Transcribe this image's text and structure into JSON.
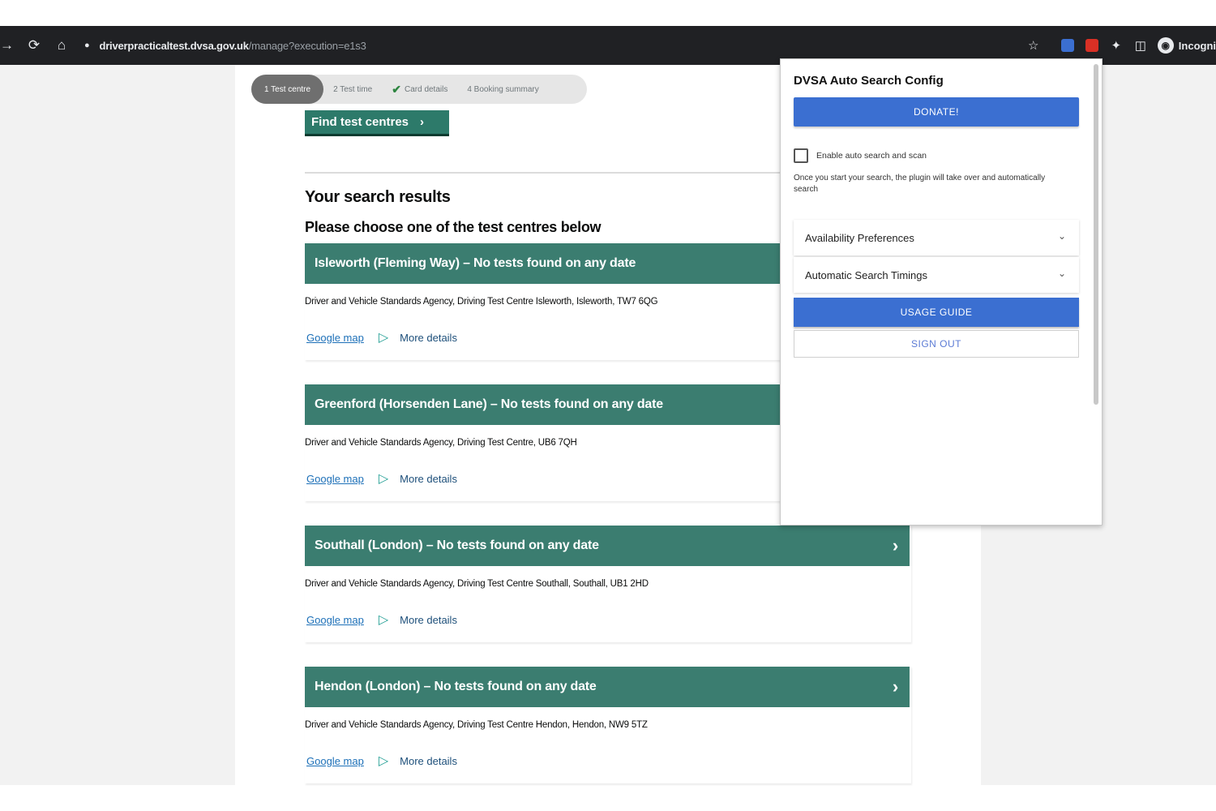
{
  "browser": {
    "url_host": "driverpracticaltest.dvsa.gov.uk",
    "url_path": "/manage?execution=e1s3",
    "profile_label": "Incogni"
  },
  "colors": {
    "toolbar": "#202124",
    "card_header": "#3b7d70",
    "find_button": "#2d7a6a",
    "popup_button": "#3b6fd1",
    "link": "#1d70b8"
  },
  "steps": [
    {
      "label": "1  Test centre",
      "state": "active"
    },
    {
      "label": "2  Test time",
      "state": "pending"
    },
    {
      "label": "Card details",
      "state": "done"
    },
    {
      "label": "4  Booking summary",
      "state": "pending"
    }
  ],
  "find_button": {
    "label": "Find test centres",
    "icon": "chevron-right-icon"
  },
  "results": {
    "heading": "Your search results",
    "subheading": "Please choose one of the test centres below",
    "google_map_label": "Google map",
    "more_details_label": "More details",
    "items": [
      {
        "title": "Isleworth (Fleming Way) – No tests found on any date",
        "address": "Driver and Vehicle Standards Agency, Driving Test Centre Isleworth, Isleworth, TW7 6QG"
      },
      {
        "title": "Greenford (Horsenden Lane) – No tests found on any date",
        "address": "Driver and Vehicle Standards Agency, Driving Test Centre, UB6 7QH"
      },
      {
        "title": "Southall (London) – No tests found on any date",
        "address": "Driver and Vehicle Standards Agency, Driving Test Centre Southall, Southall, UB1 2HD"
      },
      {
        "title": "Hendon (London) – No tests found on any date",
        "address": "Driver and Vehicle Standards Agency, Driving Test Centre Hendon, Hendon, NW9 5TZ"
      }
    ]
  },
  "popup": {
    "title": "DVSA Auto Search Config",
    "donate_label": "DONATE!",
    "checkbox_label": "Enable auto search and scan",
    "checkbox_checked": false,
    "description": "Once you start your search, the plugin will take over and automatically search",
    "accordion": [
      {
        "label": "Availability Preferences"
      },
      {
        "label": "Automatic Search Timings"
      }
    ],
    "usage_label": "USAGE GUIDE",
    "signout_label": "SIGN OUT"
  }
}
